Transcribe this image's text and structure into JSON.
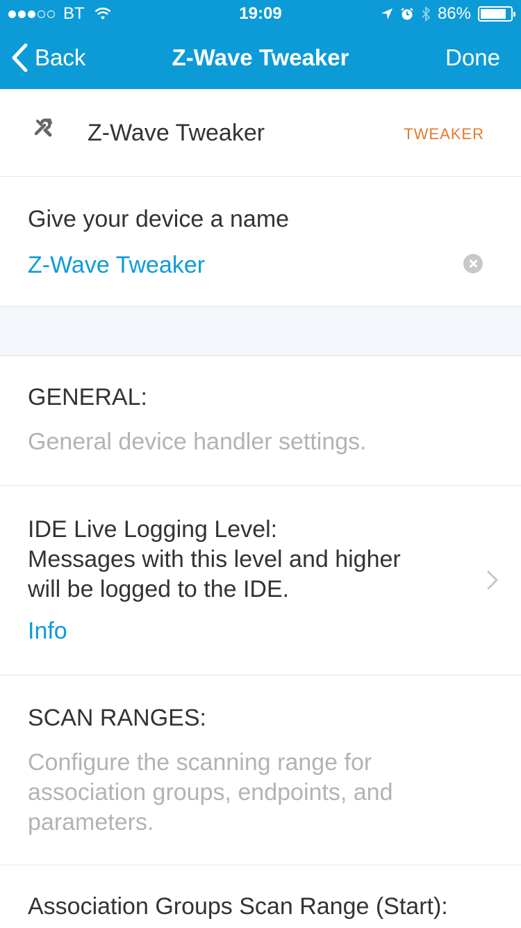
{
  "status_bar": {
    "carrier": "BT",
    "signal_filled": 3,
    "signal_total": 5,
    "time": "19:09",
    "battery_percent": "86%",
    "battery_level": 0.86
  },
  "nav": {
    "back_label": "Back",
    "title": "Z-Wave Tweaker",
    "done_label": "Done"
  },
  "device": {
    "icon": "wrench-icon",
    "name": "Z-Wave Tweaker",
    "tag": "TWEAKER"
  },
  "name_field": {
    "label": "Give your device a name",
    "value": "Z-Wave Tweaker"
  },
  "general_section": {
    "title": "GENERAL:",
    "description": "General device handler settings."
  },
  "logging_setting": {
    "label_lines": [
      "IDE Live Logging Level:",
      "Messages with this level and higher",
      "will be logged to the IDE."
    ],
    "value": "Info"
  },
  "scan_section": {
    "title": "SCAN RANGES:",
    "description_lines": [
      "Configure the scanning range for",
      "association groups, endpoints, and",
      "parameters."
    ]
  },
  "assoc_setting": {
    "label": "Association Groups Scan Range (Start):"
  },
  "colors": {
    "header_bg": "#0d9bd8",
    "accent_blue": "#0d9bd8",
    "tag_orange": "#e47a2e",
    "muted_text": "#b3b3b3",
    "spacer_bg": "#f4f7fc"
  }
}
